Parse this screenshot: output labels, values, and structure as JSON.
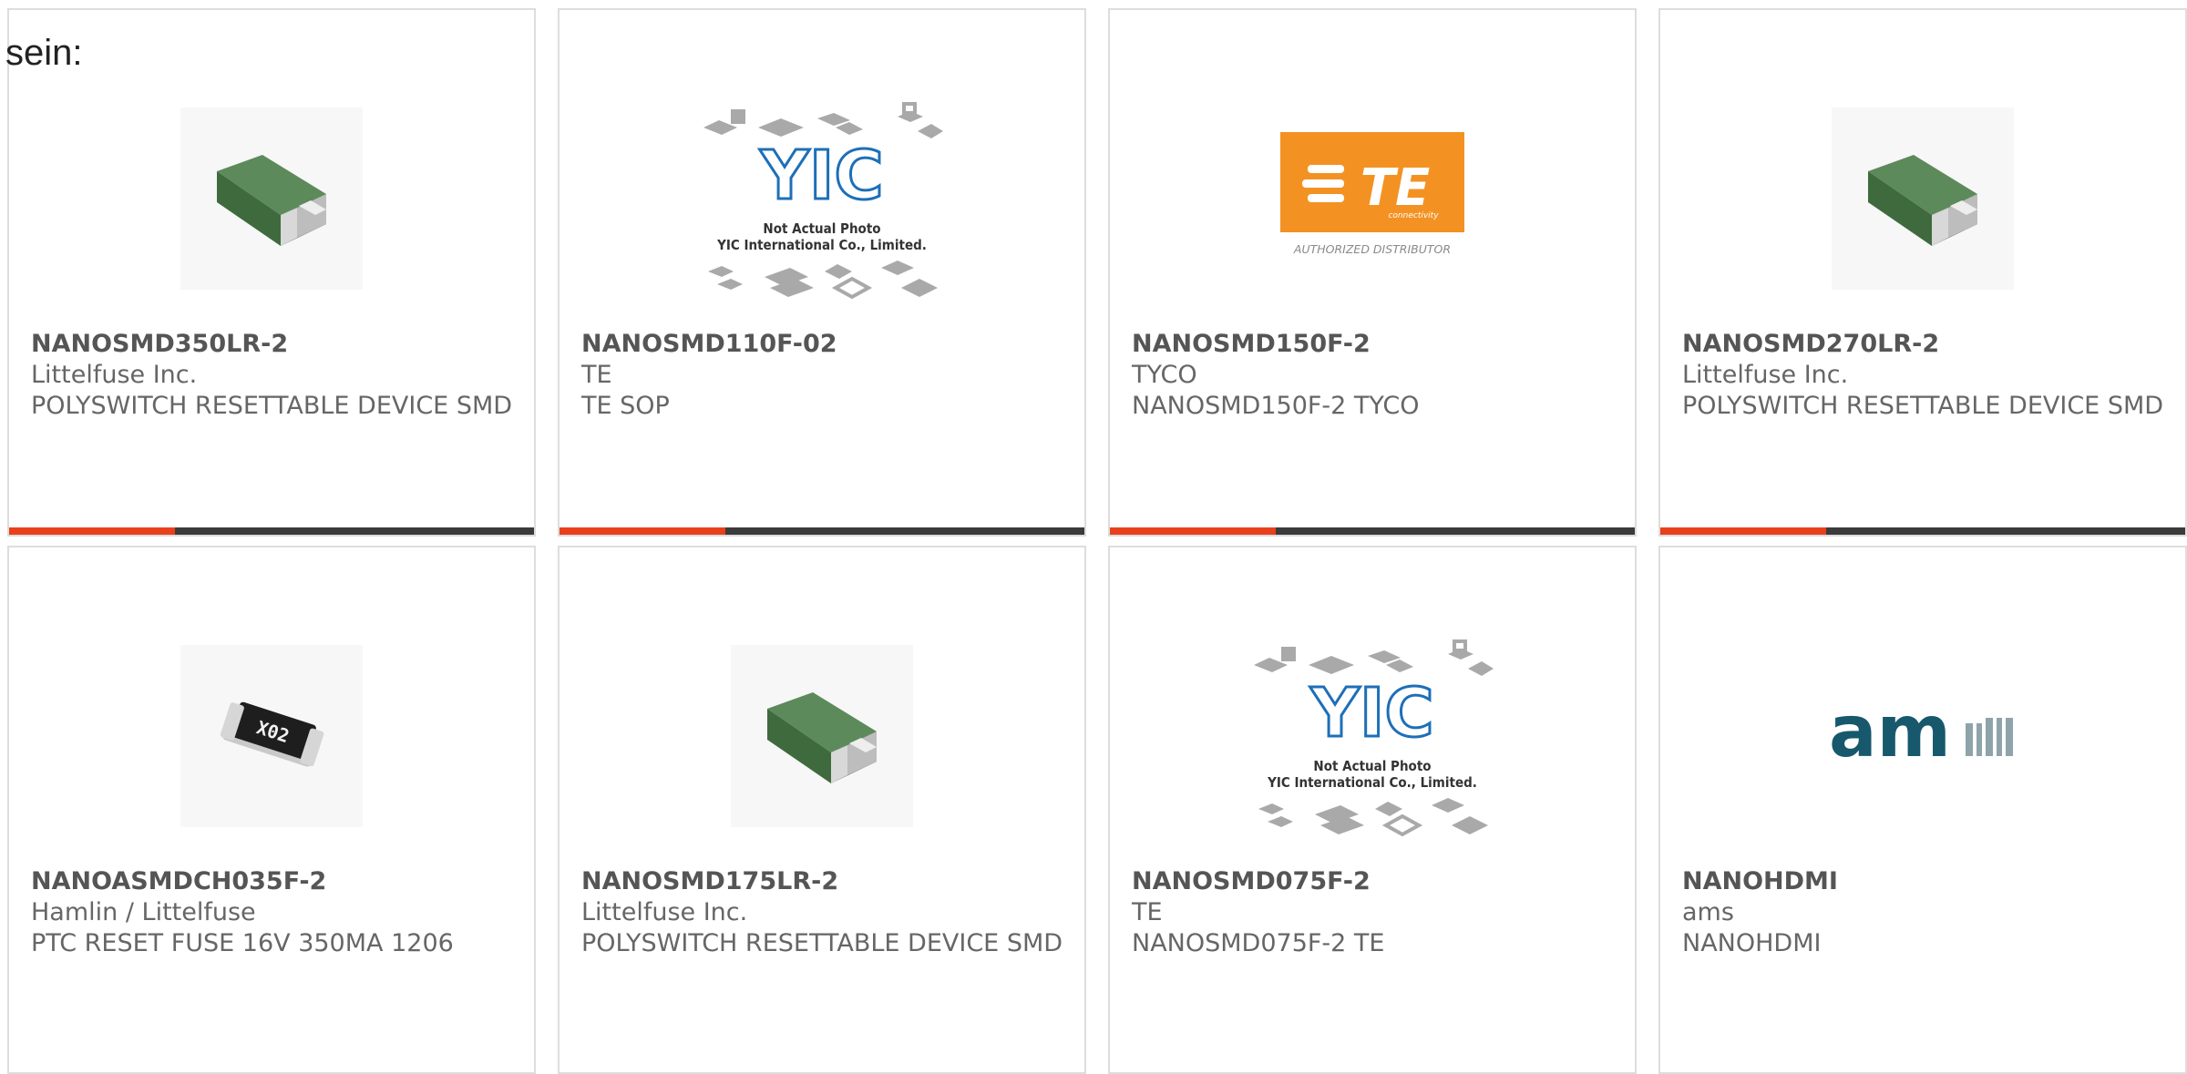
{
  "page": {
    "cutoff_heading": "sein:"
  },
  "colors": {
    "accent_bar": "#e8401c",
    "dark_bar": "#3b3b3b",
    "text_gray": "#666666"
  },
  "products": [
    {
      "part_number": "NANOSMD350LR-2",
      "manufacturer": "Littelfuse Inc.",
      "description": "POLYSWITCH RESETTABLE DEVICE SMD",
      "image": "green-smd-component"
    },
    {
      "part_number": "NANOSMD110F-02",
      "manufacturer": "TE",
      "description": "TE SOP",
      "image": "yic-placeholder",
      "image_text": {
        "logo": "YIC",
        "line1": "Not Actual Photo",
        "line2": "YIC International Co., Limited."
      }
    },
    {
      "part_number": "NANOSMD150F-2",
      "manufacturer": "TYCO",
      "description": "NANOSMD150F-2 TYCO",
      "image": "te-logo",
      "image_text": {
        "logo": "TE",
        "sub": "connectivity",
        "caption": "AUTHORIZED DISTRIBUTOR"
      }
    },
    {
      "part_number": "NANOSMD270LR-2",
      "manufacturer": "Littelfuse Inc.",
      "description": "POLYSWITCH RESETTABLE DEVICE SMD",
      "image": "green-smd-component"
    },
    {
      "part_number": "NANOASMDCH035F-2",
      "manufacturer": "Hamlin / Littelfuse",
      "description": "PTC RESET FUSE 16V 350MA 1206",
      "image": "black-fuse-component",
      "image_text": {
        "marking": "X02"
      }
    },
    {
      "part_number": "NANOSMD175LR-2",
      "manufacturer": "Littelfuse Inc.",
      "description": "POLYSWITCH RESETTABLE DEVICE SMD",
      "image": "green-smd-component"
    },
    {
      "part_number": "NANOSMD075F-2",
      "manufacturer": "TE",
      "description": "NANOSMD075F-2 TE",
      "image": "yic-placeholder",
      "image_text": {
        "logo": "YIC",
        "line1": "Not Actual Photo",
        "line2": "YIC International Co., Limited."
      }
    },
    {
      "part_number": "NANOHDMI",
      "manufacturer": "ams",
      "description": "NANOHDMI",
      "image": "ams-logo",
      "image_text": {
        "logo": "am"
      }
    }
  ]
}
